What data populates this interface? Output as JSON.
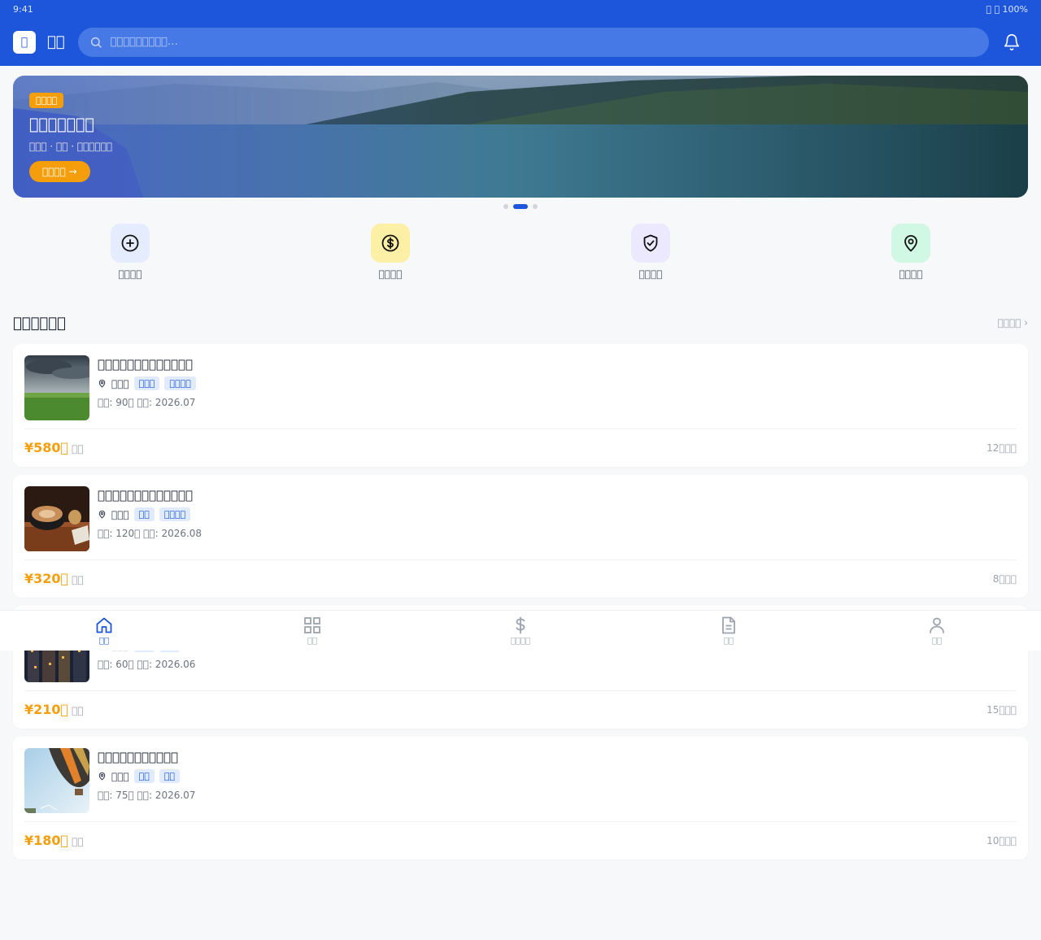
{
  "status": {
    "time": "9:41",
    "right": "￿ ￿ 100%"
  },
  "header": {
    "logo_glyph": "￿",
    "brand": "￿￿",
    "search_placeholder": "￿￿￿￿￿￿￿￿￿…"
  },
  "banner": {
    "tag": "￿￿￿￿",
    "title": "￿￿￿￿￿￿￿",
    "subtitle": "￿￿￿ · ￿￿ · ￿￿￿￿￿￿",
    "button": "￿￿￿￿ →",
    "dots": 3,
    "active_dot": 1
  },
  "quick": [
    {
      "label": "￿￿￿￿",
      "icon": "plus-circle-icon",
      "bg": "#e4ecfe"
    },
    {
      "label": "￿￿￿￿",
      "icon": "dollar-icon",
      "bg": "#fcefa6"
    },
    {
      "label": "￿￿￿￿",
      "icon": "shield-check-icon",
      "bg": "#ece9fe"
    },
    {
      "label": "￿￿￿￿",
      "icon": "location-icon",
      "bg": "#d1f7e5"
    }
  ],
  "section": {
    "title": "￿￿￿￿￿￿",
    "more": "￿￿￿￿ ›"
  },
  "cards": [
    {
      "title": "￿￿￿￿￿￿￿￿￿￿￿￿￿",
      "location": "￿￿￿",
      "tags": [
        "￿￿￿",
        "￿￿￿￿"
      ],
      "stats": "￿￿: 90￿  ￿￿: 2026.07",
      "price": "¥580￿",
      "unit": "￿￿",
      "count": "12￿￿￿",
      "image": "field"
    },
    {
      "title": "￿￿￿￿￿￿￿￿￿￿￿￿￿",
      "location": "￿￿￿",
      "tags": [
        "￿￿",
        "￿￿￿￿"
      ],
      "stats": "￿￿: 120￿  ￿￿: 2026.08",
      "price": "¥320￿",
      "unit": "￿￿",
      "count": "8￿￿￿",
      "image": "coffee"
    },
    {
      "title": "￿￿￿￿￿￿￿￿￿￿￿",
      "location": "￿￿￿",
      "tags": [
        "￿￿",
        "￿￿"
      ],
      "stats": "￿￿: 60￿  ￿￿: 2026.06",
      "price": "¥210￿",
      "unit": "￿￿",
      "count": "15￿￿￿",
      "image": "city"
    },
    {
      "title": "￿￿￿￿￿￿￿￿￿￿￿",
      "location": "￿￿￿",
      "tags": [
        "￿￿",
        "￿￿"
      ],
      "stats": "￿￿: 75￿  ￿￿: 2026.07",
      "price": "¥180￿",
      "unit": "￿￿",
      "count": "10￿￿￿",
      "image": "balloon"
    }
  ],
  "tabs": [
    {
      "label": "￿￿",
      "icon": "home-icon",
      "active": true
    },
    {
      "label": "￿￿",
      "icon": "grid-icon",
      "active": false
    },
    {
      "label": "￿￿￿￿",
      "icon": "dollar-icon",
      "active": false
    },
    {
      "label": "￿￿",
      "icon": "document-icon",
      "active": false
    },
    {
      "label": "￿￿",
      "icon": "user-icon",
      "active": false
    }
  ],
  "colors": {
    "primary": "#1d56db",
    "accent": "#f59e0b",
    "background": "#f7f8fa"
  }
}
